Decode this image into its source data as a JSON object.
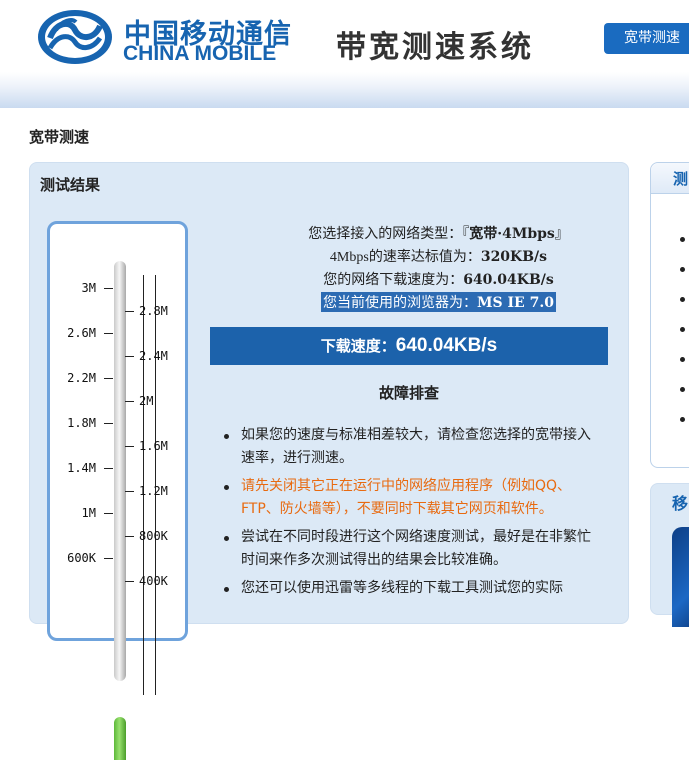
{
  "header": {
    "logo_cn": "中国移动通信",
    "logo_en": "CHINA MOBILE",
    "system_title": "带宽测速系统",
    "nav_button": "宽带测速"
  },
  "breadcrumb": "宽带测速",
  "panel": {
    "title": "测试结果",
    "gauge": {
      "left_ticks": [
        "3M",
        "2.6M",
        "2.2M",
        "1.8M",
        "1.4M",
        "1M",
        "600K"
      ],
      "right_ticks": [
        "2.8M",
        "2.4M",
        "2M",
        "1.6M",
        "1.2M",
        "800K",
        "400K"
      ],
      "fill_value_kbps": 640.04
    },
    "info": {
      "line1_prefix": "您选择接入的网络类型：『",
      "line1_value": "宽带·4Mbps",
      "line1_suffix": "』",
      "line2_prefix": "4Mbps的速率达标值为：",
      "line2_value": "320KB/s",
      "line3_prefix": "您的网络下载速度为：",
      "line3_value": "640.04KB/s",
      "line4_prefix": "您当前使用的浏览器为：",
      "line4_value": "MS IE 7.0"
    },
    "speed_bar": {
      "label": "下载速度：",
      "value": "640.04KB/s"
    },
    "troubleshoot": {
      "title": "故障排查",
      "tips": [
        "如果您的速度与标准相差较大，请检查您选择的宽带接入速率，进行测速。",
        "请先关闭其它正在运行中的网络应用程序（例如QQ、FTP、防火墙等），不要同时下载其它网页和软件。",
        "尝试在不同时段进行这个网络速度测试，最好是在非繁忙时间来作多次测试得出的结果会比较准确。",
        "您还可以使用迅雷等多线程的下载工具测试您的实际"
      ]
    }
  },
  "side": {
    "panel1_title": "测",
    "panel2_title": "移"
  },
  "colors": {
    "brand_blue": "#1764b0",
    "speed_bar": "#1c62ab",
    "panel_bg": "#dce9f6",
    "warning_orange": "#e86a10"
  }
}
